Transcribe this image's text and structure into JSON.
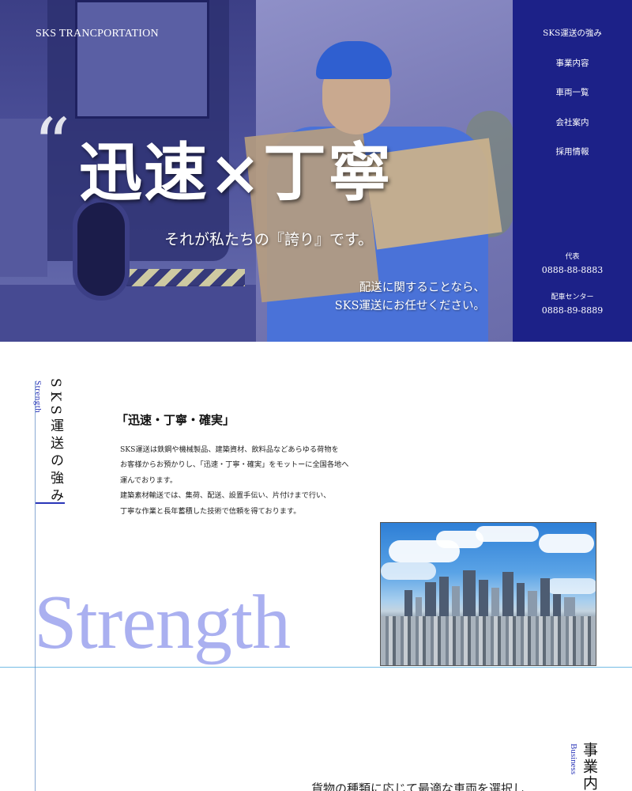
{
  "brand": {
    "logo": "SKS TRANCPORTATION"
  },
  "hero": {
    "quote_mark": "“",
    "title": "迅速×丁寧",
    "subtitle": "それが私たちの『誇り』です。",
    "desc_line1": "配送に関することなら、",
    "desc_line2": "SKS運送にお任せください。"
  },
  "nav": {
    "items": [
      {
        "label": "SKS運送の強み"
      },
      {
        "label": "事業内容"
      },
      {
        "label": "車両一覧"
      },
      {
        "label": "会社案内"
      },
      {
        "label": "採用情報"
      }
    ],
    "contacts": [
      {
        "label": "代表",
        "number": "0888-88-8883"
      },
      {
        "label": "配車センター",
        "number": "0888-89-8889"
      }
    ],
    "bg_color": "#1c2188"
  },
  "strength": {
    "vertical_en": "Strength",
    "vertical_jp": "SKS運送の強み",
    "heading": "「迅速・丁寧・確実」",
    "body": [
      "SKS運送は鉄鋼や機械製品、建築資材、飲料品などあらゆる荷物を",
      "お客様からお預かりし、「迅速・丁寧・確実」をモットーに全国各地へ",
      "運んでおります。",
      "建築素材輸送では、集荷、配送、設置手伝い、片付けまで行い、",
      "丁寧な作業と長年蓄積した技術で信頼を得ております。"
    ],
    "big_word": "Strength",
    "big_word_color": "#aab0f0"
  },
  "business": {
    "vertical_en": "Business",
    "vertical_jp": "事業内容",
    "text": "貨物の種類に応じて最適な車両を選択し"
  },
  "icons": {
    "quote": "quote-mark-icon"
  }
}
